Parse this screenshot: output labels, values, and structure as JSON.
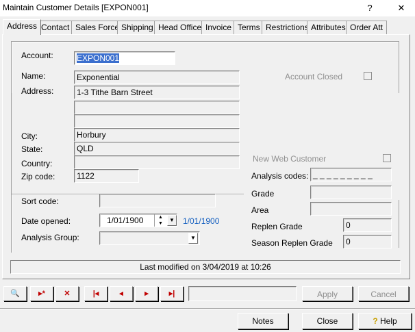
{
  "window": {
    "title": "Maintain Customer Details [EXPON001]",
    "help_glyph": "?",
    "close_glyph": "✕"
  },
  "tabs": [
    "Address",
    "Contact",
    "Sales Force",
    "Shipping",
    "Head Office",
    "Invoice",
    "Terms",
    "Restrictions",
    "Attributes",
    "Order Att"
  ],
  "form": {
    "account_label": "Account:",
    "account_value": "EXPON001",
    "name_label": "Name:",
    "name_value": "Exponential",
    "address_label": "Address:",
    "address_lines": [
      "1-3 Tithe Barn Street",
      "",
      ""
    ],
    "city_label": "City:",
    "city_value": "Horbury",
    "state_label": "State:",
    "state_value": "QLD",
    "country_label": "Country:",
    "country_value": "",
    "zip_label": "Zip code:",
    "zip_value": "1122",
    "account_closed_label": "Account Closed",
    "new_web_customer_label": "New Web Customer",
    "analysis_codes_label": "Analysis codes:",
    "analysis_codes_value": "_ _ _ _ _ _ _ _ _",
    "grade_label": "Grade",
    "grade_value": "",
    "area_label": "Area",
    "area_value": "",
    "replen_grade_label": "Replen Grade",
    "replen_grade_value": "0",
    "season_replen_grade_label": "Season Replen Grade",
    "season_replen_grade_value": "0",
    "sort_code_label": "Sort code:",
    "sort_code_value": "",
    "date_opened_label": "Date opened:",
    "date_opened_value": "1/01/1900",
    "date_opened_display": "1/01/1900",
    "analysis_group_label": "Analysis Group:",
    "analysis_group_value": ""
  },
  "status": {
    "last_modified": "Last modified on 3/04/2019 at 10:26"
  },
  "toolbar": {
    "find_glyph": "🔍",
    "new_glyph": "▸*",
    "delete_glyph": "✕",
    "first_glyph": "|◂",
    "prev_glyph": "◂",
    "next_glyph": "▸",
    "last_glyph": "▸|",
    "apply_label": "Apply",
    "cancel_label": "Cancel"
  },
  "footer": {
    "notes_label": "Notes",
    "close_label": "Close",
    "help_label": "Help"
  }
}
